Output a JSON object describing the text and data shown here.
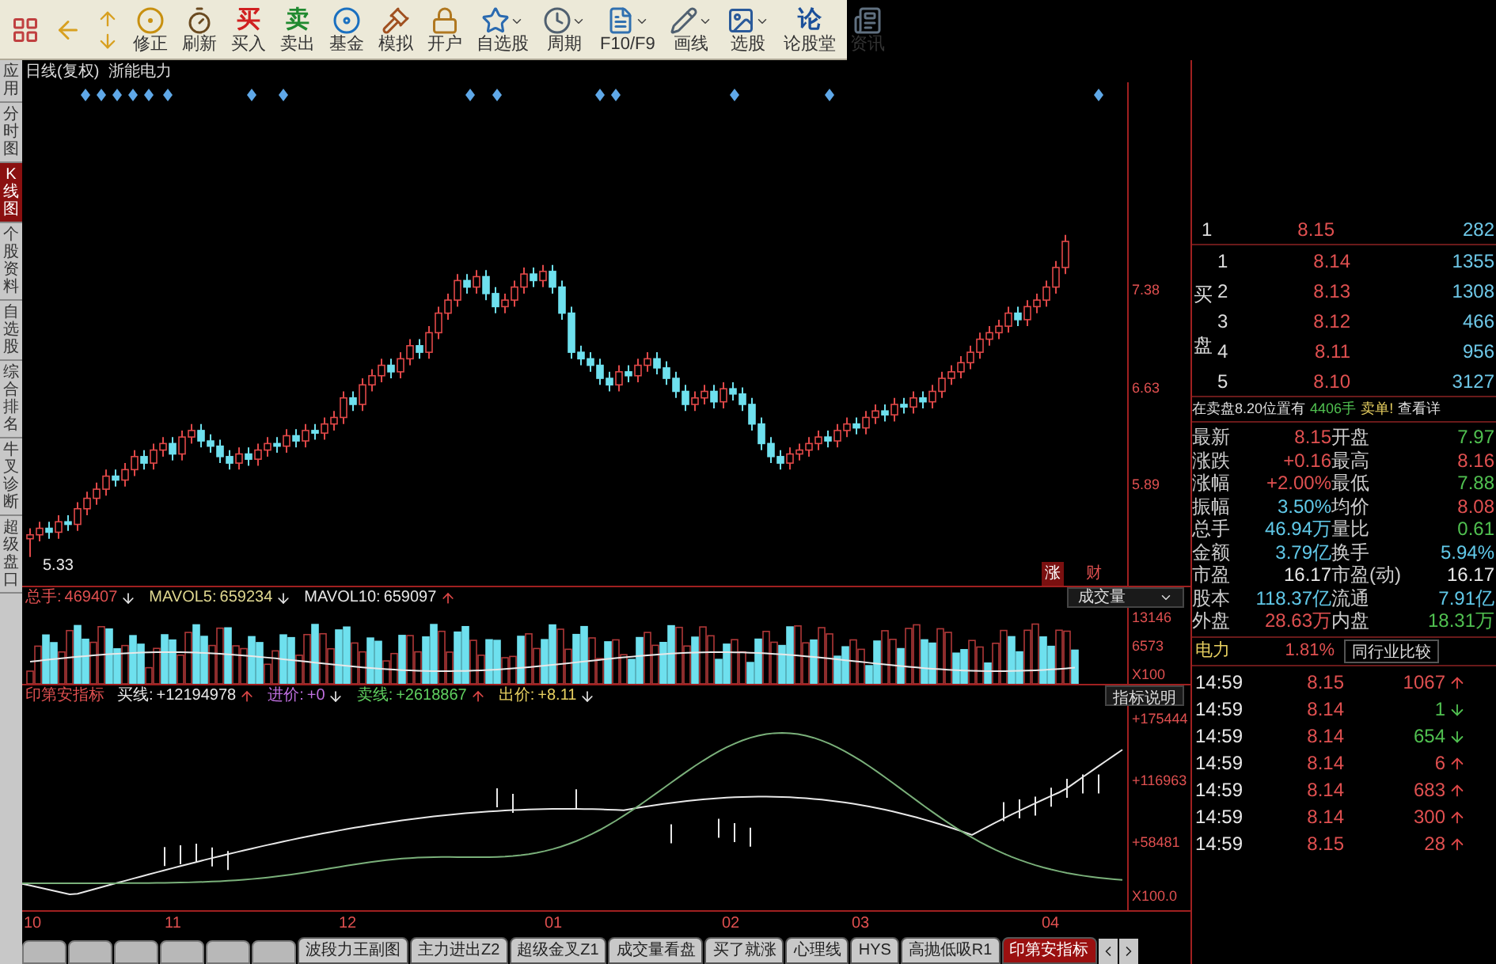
{
  "toolbar": [
    {
      "kind": "palette"
    },
    {
      "kind": "back"
    },
    {
      "kind": "updown"
    },
    {
      "kind": "dial",
      "label": "修正"
    },
    {
      "kind": "timer",
      "label": "刷新"
    },
    {
      "kind": "buy_glyph",
      "glyph": "买",
      "label": "买入"
    },
    {
      "kind": "sell_glyph",
      "glyph": "卖",
      "label": "卖出"
    },
    {
      "kind": "disc",
      "label": "基金"
    },
    {
      "kind": "gavel",
      "label": "模拟"
    },
    {
      "kind": "lock",
      "label": "开户"
    },
    {
      "kind": "star",
      "label": "自选股",
      "dropdown": true
    },
    {
      "kind": "clock",
      "label": "周期",
      "dropdown": true
    },
    {
      "kind": "doc",
      "label": "F10/F9",
      "dropdown": true
    },
    {
      "kind": "pencil",
      "label": "画线",
      "dropdown": true
    },
    {
      "kind": "picture",
      "label": "选股",
      "dropdown": true
    },
    {
      "kind": "forum_glyph",
      "glyph": "论",
      "label": "论股堂"
    },
    {
      "kind": "news",
      "label": "资讯"
    }
  ],
  "sidebar": [
    {
      "label": "应用",
      "selected": false
    },
    {
      "label": "分时图",
      "selected": false
    },
    {
      "label": "K线图",
      "selected": true
    },
    {
      "label": "个股资料",
      "selected": false
    },
    {
      "label": "自选股",
      "selected": false
    },
    {
      "label": "综合排名",
      "selected": false
    },
    {
      "label": "牛叉诊断",
      "selected": false
    },
    {
      "label": "超级盘口",
      "selected": false
    }
  ],
  "price_chart": {
    "period": "日线(复权)",
    "stock": "浙能电力",
    "low_label": "5.33",
    "tags": [
      "涨",
      "财"
    ],
    "chart_data": {
      "type": "candlestick",
      "ylim": [
        5.11,
        8.97
      ],
      "yticks": [
        {
          "value": 7.38,
          "label": "7.38"
        },
        {
          "value": 6.63,
          "label": "6.63"
        },
        {
          "value": 5.89,
          "label": "5.89"
        }
      ],
      "ohlc": [
        [
          5.47,
          5.55,
          5.33,
          5.5
        ],
        [
          5.5,
          5.6,
          5.45,
          5.55
        ],
        [
          5.55,
          5.6,
          5.47,
          5.52
        ],
        [
          5.52,
          5.65,
          5.47,
          5.6
        ],
        [
          5.6,
          5.65,
          5.53,
          5.58
        ],
        [
          5.58,
          5.75,
          5.53,
          5.7
        ],
        [
          5.7,
          5.83,
          5.65,
          5.78
        ],
        [
          5.78,
          5.9,
          5.73,
          5.85
        ],
        [
          5.85,
          6.0,
          5.8,
          5.95
        ],
        [
          5.95,
          6.0,
          5.87,
          5.92
        ],
        [
          5.92,
          6.05,
          5.87,
          6.0
        ],
        [
          6.0,
          6.15,
          5.95,
          6.1
        ],
        [
          6.1,
          6.15,
          6.0,
          6.05
        ],
        [
          6.05,
          6.2,
          6.0,
          6.15
        ],
        [
          6.15,
          6.25,
          6.1,
          6.2
        ],
        [
          6.2,
          6.25,
          6.07,
          6.12
        ],
        [
          6.12,
          6.3,
          6.07,
          6.25
        ],
        [
          6.25,
          6.35,
          6.2,
          6.3
        ],
        [
          6.3,
          6.35,
          6.17,
          6.22
        ],
        [
          6.22,
          6.27,
          6.13,
          6.18
        ],
        [
          6.18,
          6.23,
          6.05,
          6.1
        ],
        [
          6.1,
          6.15,
          6.0,
          6.05
        ],
        [
          6.05,
          6.17,
          6.0,
          6.12
        ],
        [
          6.12,
          6.17,
          6.03,
          6.08
        ],
        [
          6.08,
          6.2,
          6.03,
          6.15
        ],
        [
          6.15,
          6.25,
          6.1,
          6.2
        ],
        [
          6.2,
          6.25,
          6.13,
          6.18
        ],
        [
          6.18,
          6.31,
          6.13,
          6.26
        ],
        [
          6.26,
          6.31,
          6.17,
          6.22
        ],
        [
          6.22,
          6.35,
          6.17,
          6.3
        ],
        [
          6.3,
          6.35,
          6.23,
          6.28
        ],
        [
          6.28,
          6.4,
          6.23,
          6.35
        ],
        [
          6.35,
          6.45,
          6.3,
          6.4
        ],
        [
          6.4,
          6.6,
          6.35,
          6.55
        ],
        [
          6.55,
          6.6,
          6.45,
          6.5
        ],
        [
          6.5,
          6.7,
          6.45,
          6.65
        ],
        [
          6.65,
          6.77,
          6.6,
          6.72
        ],
        [
          6.72,
          6.85,
          6.67,
          6.8
        ],
        [
          6.8,
          6.85,
          6.7,
          6.75
        ],
        [
          6.75,
          6.9,
          6.7,
          6.85
        ],
        [
          6.85,
          7.0,
          6.8,
          6.95
        ],
        [
          6.95,
          7.0,
          6.85,
          6.9
        ],
        [
          6.9,
          7.1,
          6.85,
          7.05
        ],
        [
          7.05,
          7.25,
          7.0,
          7.2
        ],
        [
          7.2,
          7.35,
          7.15,
          7.3
        ],
        [
          7.3,
          7.5,
          7.25,
          7.45
        ],
        [
          7.45,
          7.5,
          7.35,
          7.4
        ],
        [
          7.4,
          7.53,
          7.35,
          7.48
        ],
        [
          7.48,
          7.53,
          7.3,
          7.35
        ],
        [
          7.35,
          7.4,
          7.2,
          7.25
        ],
        [
          7.25,
          7.35,
          7.2,
          7.3
        ],
        [
          7.3,
          7.45,
          7.25,
          7.4
        ],
        [
          7.4,
          7.55,
          7.35,
          7.5
        ],
        [
          7.5,
          7.55,
          7.4,
          7.45
        ],
        [
          7.45,
          7.57,
          7.4,
          7.52
        ],
        [
          7.52,
          7.57,
          7.35,
          7.4
        ],
        [
          7.4,
          7.45,
          7.15,
          7.2
        ],
        [
          7.2,
          7.25,
          6.85,
          6.9
        ],
        [
          6.9,
          6.95,
          6.8,
          6.85
        ],
        [
          6.85,
          6.9,
          6.75,
          6.8
        ],
        [
          6.8,
          6.85,
          6.65,
          6.7
        ],
        [
          6.7,
          6.75,
          6.6,
          6.65
        ],
        [
          6.65,
          6.8,
          6.6,
          6.75
        ],
        [
          6.75,
          6.8,
          6.67,
          6.72
        ],
        [
          6.72,
          6.85,
          6.67,
          6.8
        ],
        [
          6.8,
          6.9,
          6.75,
          6.85
        ],
        [
          6.85,
          6.9,
          6.73,
          6.78
        ],
        [
          6.78,
          6.83,
          6.65,
          6.7
        ],
        [
          6.7,
          6.75,
          6.55,
          6.6
        ],
        [
          6.6,
          6.65,
          6.45,
          6.5
        ],
        [
          6.5,
          6.6,
          6.45,
          6.55
        ],
        [
          6.55,
          6.65,
          6.5,
          6.6
        ],
        [
          6.6,
          6.65,
          6.47,
          6.52
        ],
        [
          6.52,
          6.67,
          6.47,
          6.62
        ],
        [
          6.62,
          6.67,
          6.53,
          6.58
        ],
        [
          6.58,
          6.63,
          6.45,
          6.5
        ],
        [
          6.5,
          6.55,
          6.3,
          6.35
        ],
        [
          6.35,
          6.4,
          6.15,
          6.2
        ],
        [
          6.2,
          6.25,
          6.05,
          6.1
        ],
        [
          6.1,
          6.15,
          6.0,
          6.05
        ],
        [
          6.05,
          6.17,
          6.0,
          6.12
        ],
        [
          6.12,
          6.2,
          6.07,
          6.15
        ],
        [
          6.15,
          6.25,
          6.1,
          6.2
        ],
        [
          6.2,
          6.3,
          6.15,
          6.25
        ],
        [
          6.25,
          6.3,
          6.17,
          6.22
        ],
        [
          6.22,
          6.35,
          6.17,
          6.3
        ],
        [
          6.3,
          6.4,
          6.25,
          6.35
        ],
        [
          6.35,
          6.4,
          6.27,
          6.32
        ],
        [
          6.32,
          6.45,
          6.27,
          6.4
        ],
        [
          6.4,
          6.5,
          6.35,
          6.45
        ],
        [
          6.45,
          6.5,
          6.37,
          6.42
        ],
        [
          6.42,
          6.55,
          6.37,
          6.5
        ],
        [
          6.5,
          6.55,
          6.43,
          6.48
        ],
        [
          6.48,
          6.6,
          6.43,
          6.55
        ],
        [
          6.55,
          6.6,
          6.47,
          6.52
        ],
        [
          6.52,
          6.65,
          6.47,
          6.6
        ],
        [
          6.6,
          6.75,
          6.55,
          6.7
        ],
        [
          6.7,
          6.8,
          6.65,
          6.75
        ],
        [
          6.75,
          6.87,
          6.7,
          6.82
        ],
        [
          6.82,
          6.95,
          6.77,
          6.9
        ],
        [
          6.9,
          7.05,
          6.85,
          7.0
        ],
        [
          7.0,
          7.1,
          6.95,
          7.05
        ],
        [
          7.05,
          7.15,
          7.0,
          7.1
        ],
        [
          7.1,
          7.25,
          7.05,
          7.2
        ],
        [
          7.2,
          7.25,
          7.1,
          7.15
        ],
        [
          7.15,
          7.3,
          7.1,
          7.25
        ],
        [
          7.25,
          7.35,
          7.2,
          7.3
        ],
        [
          7.3,
          7.45,
          7.25,
          7.4
        ],
        [
          7.4,
          7.6,
          7.35,
          7.55
        ],
        [
          7.55,
          7.8,
          7.5,
          7.75
        ]
      ]
    }
  },
  "volume_panel": {
    "legend": [
      {
        "label": "总手:",
        "value": "469407",
        "color": "#e05050",
        "rising": false
      },
      {
        "label": "MAVOL5:",
        "value": "659234",
        "color": "#e0d890",
        "rising": false
      },
      {
        "label": "MAVOL10:",
        "value": "659097",
        "color": "#e8e8e8",
        "rising": true
      }
    ],
    "selector": "成交量",
    "axis": [
      "13146",
      "6573",
      "X100"
    ]
  },
  "indicator_panel": {
    "title": "印第安指标",
    "legend": [
      {
        "label": "买线:",
        "value": "+12194978",
        "color": "#e8e8e8",
        "rising": true
      },
      {
        "label": "进价:",
        "value": "+0",
        "color": "#c070e0",
        "rising": false
      },
      {
        "label": "卖线:",
        "value": "+2618867",
        "color": "#60d060",
        "rising": true
      },
      {
        "label": "出价:",
        "value": "+8.11",
        "color": "#e8d060",
        "rising": false
      }
    ],
    "help_button": "指标说明",
    "axis": [
      "+175444",
      "+116963",
      "+58481",
      "X100.0"
    ]
  },
  "x_axis": [
    "10",
    "11",
    "12",
    "01",
    "02",
    "03",
    "04"
  ],
  "bottom_tabs": [
    {
      "kind": "illegible",
      "selected": false
    },
    {
      "kind": "illegible",
      "selected": false
    },
    {
      "kind": "illegible",
      "selected": false
    },
    {
      "kind": "illegible",
      "selected": false
    },
    {
      "kind": "illegible",
      "selected": false
    },
    {
      "kind": "illegible",
      "selected": false
    },
    {
      "kind": "tab",
      "label": "波段力王副图",
      "selected": false
    },
    {
      "kind": "tab",
      "label": "主力进出Z2",
      "selected": false
    },
    {
      "kind": "tab",
      "label": "超级金叉Z1",
      "selected": false
    },
    {
      "kind": "tab",
      "label": "成交量看盘",
      "selected": false
    },
    {
      "kind": "tab",
      "label": "买了就涨",
      "selected": false
    },
    {
      "kind": "tab",
      "label": "心理线",
      "selected": false
    },
    {
      "kind": "tab",
      "label": "HYS",
      "selected": false
    },
    {
      "kind": "tab",
      "label": "高抛低吸R1",
      "selected": false
    },
    {
      "kind": "tab",
      "label": "印第安指标",
      "selected": true
    }
  ],
  "order_book": {
    "sell": [
      {
        "level": "1",
        "price": "8.15",
        "volume": "282"
      }
    ],
    "buy_label": "买盘",
    "buy": [
      {
        "level": "1",
        "price": "8.14",
        "volume": "1355"
      },
      {
        "level": "2",
        "price": "8.13",
        "volume": "1308"
      },
      {
        "level": "3",
        "price": "8.12",
        "volume": "466"
      },
      {
        "level": "4",
        "price": "8.11",
        "volume": "956"
      },
      {
        "level": "5",
        "price": "8.10",
        "volume": "3127"
      }
    ]
  },
  "alert": {
    "text": "在卖盘8.20位置有",
    "amount": "4406手",
    "kind_text": "卖单!",
    "link": "查看详"
  },
  "stats": [
    {
      "left": {
        "label": "最新",
        "value": "8.15",
        "color": "#e05050"
      },
      "right": {
        "label": "开盘",
        "value": "7.97",
        "color": "#50c050"
      }
    },
    {
      "left": {
        "label": "涨跌",
        "value": "+0.16",
        "color": "#e05050"
      },
      "right": {
        "label": "最高",
        "value": "8.16",
        "color": "#e05050"
      }
    },
    {
      "left": {
        "label": "涨幅",
        "value": "+2.00%",
        "color": "#e05050"
      },
      "right": {
        "label": "最低",
        "value": "7.88",
        "color": "#50c050"
      }
    },
    {
      "left": {
        "label": "振幅",
        "value": "3.50%",
        "color": "#60c8e8"
      },
      "right": {
        "label": "均价",
        "value": "8.08",
        "color": "#e05050"
      }
    },
    {
      "left": {
        "label": "总手",
        "value": "46.94万",
        "color": "#60c8e8"
      },
      "right": {
        "label": "量比",
        "value": "0.61",
        "color": "#50c050"
      }
    },
    {
      "left": {
        "label": "金额",
        "value": "3.79亿",
        "color": "#60c8e8"
      },
      "right": {
        "label": "换手",
        "value": "5.94%",
        "color": "#60c8e8"
      }
    },
    {
      "left": {
        "label": "市盈",
        "value": "16.17",
        "color": "#e8e8e8"
      },
      "right": {
        "label": "市盈(动)",
        "value": "16.17",
        "color": "#e8e8e8"
      }
    },
    {
      "left": {
        "label": "股本",
        "value": "118.37亿",
        "color": "#60c8e8"
      },
      "right": {
        "label": "流通",
        "value": "7.91亿",
        "color": "#60c8e8"
      }
    },
    {
      "left": {
        "label": "外盘",
        "value": "28.63万",
        "color": "#e05050"
      },
      "right": {
        "label": "内盘",
        "value": "18.31万",
        "color": "#50c050"
      }
    }
  ],
  "industry": {
    "name": "电力",
    "change": "1.81%",
    "button": "同行业比较"
  },
  "ticks": [
    {
      "time": "14:59",
      "price": "8.15",
      "volume": "1067",
      "rising": true
    },
    {
      "time": "14:59",
      "price": "8.14",
      "volume": "1",
      "rising": false
    },
    {
      "time": "14:59",
      "price": "8.14",
      "volume": "654",
      "rising": false
    },
    {
      "time": "14:59",
      "price": "8.14",
      "volume": "6",
      "rising": true
    },
    {
      "time": "14:59",
      "price": "8.14",
      "volume": "683",
      "rising": true
    },
    {
      "time": "14:59",
      "price": "8.14",
      "volume": "300",
      "rising": true
    },
    {
      "time": "14:59",
      "price": "8.15",
      "volume": "28",
      "rising": true
    }
  ]
}
